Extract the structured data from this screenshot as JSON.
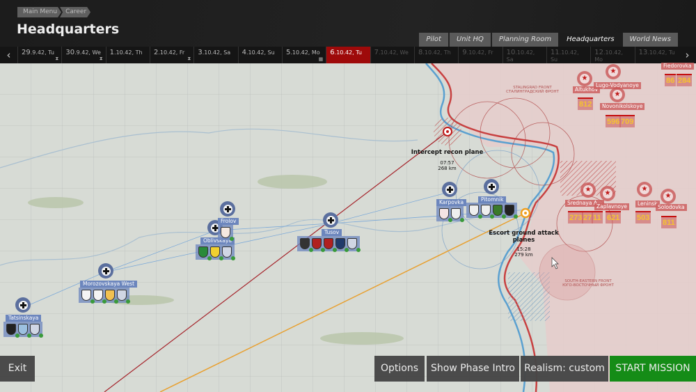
{
  "breadcrumb": [
    "Main Menu",
    "Career"
  ],
  "page_title": "Headquarters",
  "tabs": [
    {
      "label": "Pilot"
    },
    {
      "label": "Unit HQ"
    },
    {
      "label": "Planning Room"
    },
    {
      "label": "Headquarters",
      "active": true
    },
    {
      "label": "World News"
    }
  ],
  "dates": [
    {
      "day": "29",
      "rest": ".9.42, Tu",
      "state": "past"
    },
    {
      "day": "30",
      "rest": ".9.42, We",
      "state": "past"
    },
    {
      "day": "1",
      "rest": ".10.42, Th",
      "state": "past"
    },
    {
      "day": "2",
      "rest": ".10.42, Fr",
      "state": "past"
    },
    {
      "day": "3",
      "rest": ".10.42, Sa",
      "state": "past"
    },
    {
      "day": "4",
      "rest": ".10.42, Su",
      "state": "past"
    },
    {
      "day": "5",
      "rest": ".10.42, Mo",
      "state": "past"
    },
    {
      "day": "6",
      "rest": ".10.42, Tu",
      "state": "selected"
    },
    {
      "day": "7",
      "rest": ".10.42, We",
      "state": "future"
    },
    {
      "day": "8",
      "rest": ".10.42, Th",
      "state": "future"
    },
    {
      "day": "9",
      "rest": ".10.42, Fr",
      "state": "future"
    },
    {
      "day": "10",
      "rest": ".10.42, Sa",
      "state": "future"
    },
    {
      "day": "11",
      "rest": ".10.42, Su",
      "state": "future"
    },
    {
      "day": "12",
      "rest": ".10.42, Mo",
      "state": "future"
    },
    {
      "day": "13",
      "rest": ".10.42, Tu",
      "state": "future"
    }
  ],
  "missions": [
    {
      "title": "Intercept recon plane",
      "time": "07:57",
      "distance": "268 km",
      "color": "#a5232a"
    },
    {
      "title": "Escort ground attack planes",
      "time": "15:28",
      "distance": "279 km",
      "color": "#e8a030"
    }
  ],
  "fronts": [
    {
      "en": "STALINGRAD FRONT",
      "ru": "СТАЛИНГРАДСКИЙ ФРОНТ"
    },
    {
      "en": "SOUTH-EASTERN FRONT",
      "ru": "ЮГО-ВОСТОЧНЫЙ ФРОНТ"
    }
  ],
  "german_airfields": [
    {
      "name": "Tatsinskaya",
      "units": [
        "black-lion-emblem",
        "blue-shield-emblem",
        "aircraft-emblem"
      ]
    },
    {
      "name": "Morozovskaya West",
      "units": [
        "eagle-emblem",
        "eagle-emblem",
        "ship-emblem",
        "aircraft-emblem"
      ]
    },
    {
      "name": "Oblivskaya",
      "units": [
        "green-emblem",
        "yellow-emblem",
        "aircraft-emblem"
      ]
    },
    {
      "name": "Frolov",
      "units": [
        "red-dragon-emblem"
      ]
    },
    {
      "name": "Tusov",
      "units": [
        "dark-emblem",
        "red-emblem",
        "red-emblem",
        "blue-emblem",
        "aircraft-emblem"
      ]
    },
    {
      "name": "Karpovka",
      "units": [
        "red-eagle-emblem",
        "cross-emblem"
      ]
    },
    {
      "name": "Pitomnik",
      "units": [
        "crossed-swords-emblem",
        "axe-emblem",
        "green-shield-emblem",
        "black-horse-emblem"
      ]
    }
  ],
  "soviet_airfields": [
    {
      "name": "Altukhov",
      "counts": [
        "812"
      ]
    },
    {
      "name": "Lugo-Vodyanoye",
      "counts": []
    },
    {
      "name": "Novonikolskoye",
      "counts": [
        "596",
        "709"
      ]
    },
    {
      "name": "Fiedorovka",
      "counts": [
        "86",
        "284"
      ]
    },
    {
      "name": "Srednaya A...",
      "counts": [
        "273",
        "27"
      ]
    },
    {
      "name": "Zaplavnoye",
      "counts": [
        "11",
        "621"
      ]
    },
    {
      "name": "Leninsk",
      "counts": [
        "503"
      ]
    },
    {
      "name": "Solodovka",
      "counts": [
        "811"
      ]
    }
  ],
  "buttons": {
    "exit": "Exit",
    "options": "Options",
    "phase_intro": "Show Phase Intro",
    "realism": "Realism: custom",
    "start": "START MISSION"
  },
  "colors": {
    "start": "#0f8a12",
    "selected_day": "#9e0a0a",
    "german": "#6c86bd",
    "soviet": "#cd5f5f"
  }
}
